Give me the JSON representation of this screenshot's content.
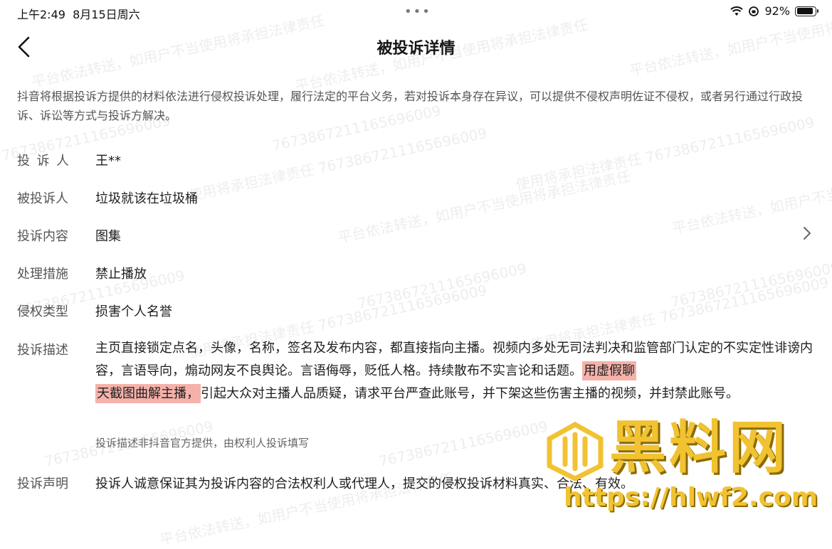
{
  "status_bar": {
    "time": "上午2:49",
    "date": "8月15日周六",
    "dots": "•••",
    "battery_pct": "92%",
    "battery_level": 0.92
  },
  "nav": {
    "title": "被投诉详情"
  },
  "notice": "抖音将根据投诉方提供的材料依法进行侵权投诉处理，履行法定的平台义务，若对投诉本身存在异议，可以提供不侵权声明佐证不侵权，或者另行通过行政投诉、诉讼等方式与投诉方解决。",
  "fields": {
    "complainant": {
      "label": "投诉人",
      "value": "王**"
    },
    "respondent": {
      "label": "被投诉人",
      "value": "垃圾就该在垃圾桶"
    },
    "content": {
      "label": "投诉内容",
      "value": "图集"
    },
    "measure": {
      "label": "处理措施",
      "value": "禁止播放"
    },
    "type": {
      "label": "侵权类型",
      "value": "损害个人名誉"
    },
    "description": {
      "label": "投诉描述",
      "text_before": "主页直接锁定点名，头像，名称，签名及发布内容，都直接指向主播。视频内多处无司法判决和监管部门认定的不实定性诽谤内容，言语导向，煽动网友不良舆论。言语侮辱，贬低人格。持续散布不实言论和话题。",
      "highlight_1": "用虚假聊",
      "highlight_2": "天截图曲解主播，",
      "text_after": "引起大众对主播人品质疑，请求平台严查此账号，并下架这些伤害主播的视频，并封禁此账号。",
      "note": "投诉描述非抖音官方提供，由权利人投诉填写"
    },
    "statement": {
      "label": "投诉声明",
      "value": "投诉人诚意保证其为投诉内容的合法权利人或代理人，提交的侵权投诉材料真实、合法、有效。"
    }
  },
  "watermark": {
    "line_a": "平台依法转送，如用户不当使用将承担法律责任",
    "line_b": "7673867211165696009",
    "line_c": "使用将承担法律责任 7673867211165696009"
  },
  "logo": {
    "brand": "黑料网",
    "url": "https://hlwf2.com"
  },
  "colors": {
    "highlight": "#f5b2aa",
    "logo_gold": "#f1c232"
  }
}
